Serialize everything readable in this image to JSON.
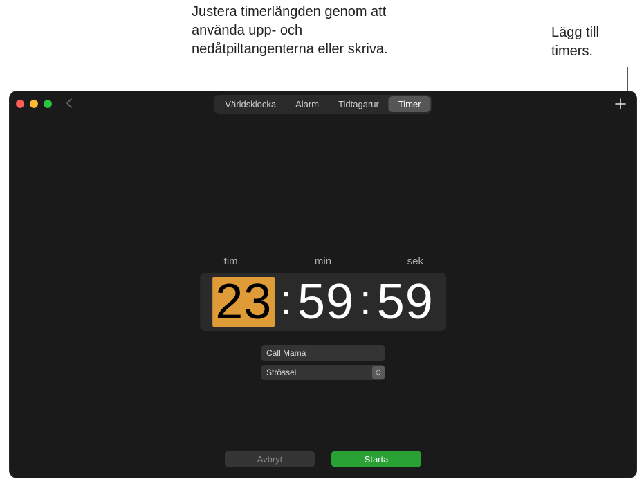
{
  "annotations": {
    "adjust": "Justera timerlängden genom att använda upp- och nedåtpiltangenterna eller skriva.",
    "add_timers": "Lägg till timers."
  },
  "segmented": {
    "world_clock": "Världsklocka",
    "alarm": "Alarm",
    "stopwatch": "Tidtagarur",
    "timer": "Timer"
  },
  "units": {
    "hours": "tim",
    "minutes": "min",
    "seconds": "sek"
  },
  "time": {
    "hours": "23",
    "minutes": "59",
    "seconds": "59"
  },
  "label_field": {
    "value": "Call Mama"
  },
  "sound_select": {
    "value": "Strössel"
  },
  "buttons": {
    "cancel": "Avbryt",
    "start": "Starta"
  }
}
